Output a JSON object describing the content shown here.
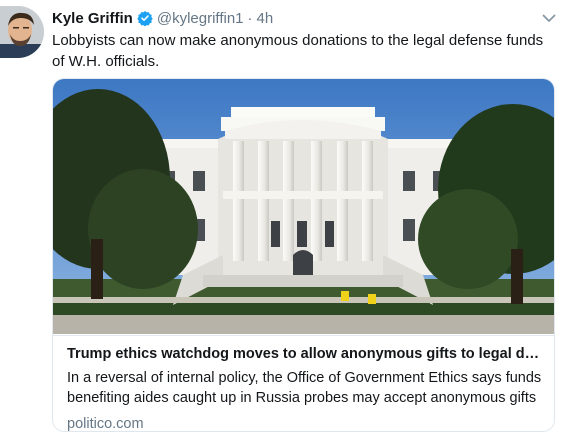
{
  "tweet": {
    "author_name": "Kyle Griffin",
    "handle": "@kylegriffin1",
    "separator": "·",
    "time": "4h",
    "text": "Lobbyists can now make anonymous donations to the legal defense funds of W.H. officials.",
    "icons": {
      "verified": "verified-badge-icon",
      "menu": "chevron-down-icon"
    }
  },
  "card": {
    "title": "Trump ethics watchdog moves to allow anonymous gifts to legal def…",
    "description": "In a reversal of internal policy, the Office of Government Ethics says funds benefiting aides caught up in Russia probes may accept anonymous gifts ...",
    "domain": "politico.com"
  },
  "colors": {
    "verified_blue": "#1da1f2",
    "muted_text": "#657786",
    "border": "#e1e8ed"
  }
}
